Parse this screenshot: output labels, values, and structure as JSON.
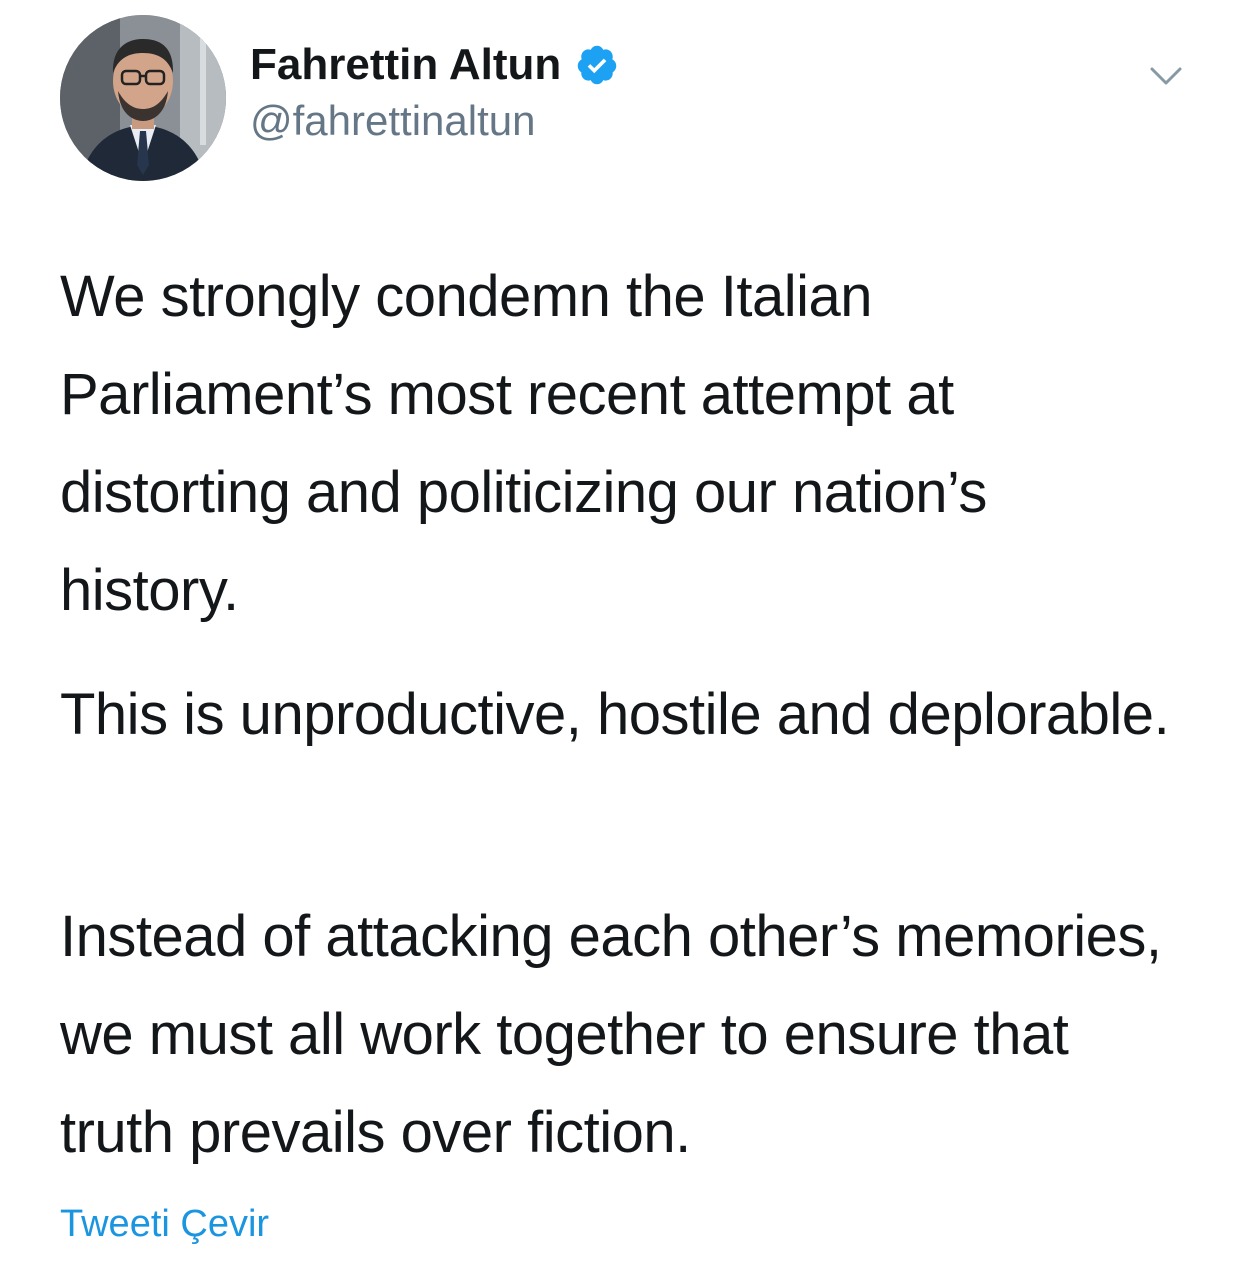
{
  "tweet": {
    "author": {
      "display_name": "Fahrettin Altun",
      "handle": "@fahrettinaltun",
      "verified": true,
      "avatar_icon": "profile-photo"
    },
    "menu_icon": "chevron-down-icon",
    "paragraphs": [
      "We strongly condemn the Italian Parliament’s most recent attempt at distorting and politicizing our nation’s history.",
      "This is unproductive, hostile and deplorable.",
      "Instead of attacking each other’s memories, we must all work together to ensure that truth prevails over fiction."
    ],
    "translate_label": "Tweeti Çevir"
  },
  "colors": {
    "text": "#14171a",
    "secondary": "#657786",
    "link": "#1b95e0",
    "verified": "#1da1f2",
    "background": "#ffffff"
  }
}
